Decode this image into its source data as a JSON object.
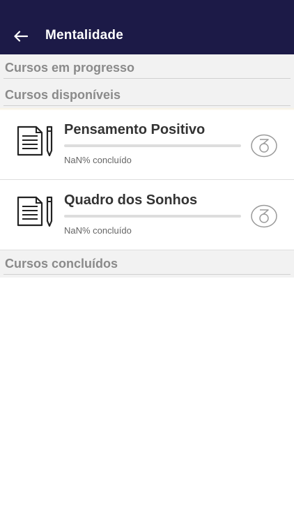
{
  "header": {
    "title": "Mentalidade",
    "back_icon": "arrow-left-icon",
    "background": "#1c1a47"
  },
  "sections": {
    "in_progress": "Cursos em progresso",
    "available": "Cursos disponíveis",
    "completed": "Cursos concluídos"
  },
  "courses": [
    {
      "name": "Pensamento Positivo",
      "progress_text": "NaN% concluído",
      "progress": 0,
      "icon": "document-pencil-icon",
      "badge_icon": "medal-icon"
    },
    {
      "name": "Quadro dos Sonhos",
      "progress_text": "NaN% concluído",
      "progress": 0,
      "icon": "document-pencil-icon",
      "badge_icon": "medal-icon"
    }
  ]
}
